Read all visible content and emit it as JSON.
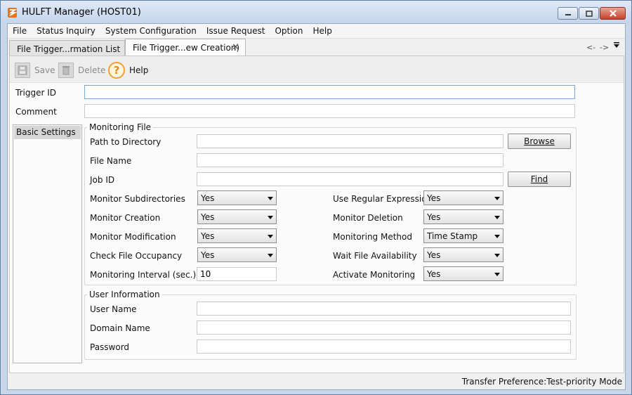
{
  "window": {
    "title": "HULFT Manager (HOST01)",
    "colors": {
      "frame": "#c7d6e9",
      "close": "#c7412b",
      "accent": "#f0a030"
    }
  },
  "menu": [
    {
      "label": "File"
    },
    {
      "label": "Status Inquiry"
    },
    {
      "label": "System Configuration"
    },
    {
      "label": "Issue Request"
    },
    {
      "label": "Option"
    },
    {
      "label": "Help"
    }
  ],
  "tabs": [
    {
      "label": "File Trigger...rmation List"
    },
    {
      "label": "File Trigger...ew Creation)"
    }
  ],
  "tab_nav": {
    "back": "<-",
    "forward": "->"
  },
  "toolbar": {
    "save": {
      "label": "Save",
      "icon": "save-icon"
    },
    "delete": {
      "label": "Delete",
      "icon": "trash-icon"
    },
    "help": {
      "label": "Help",
      "icon": "help-icon"
    }
  },
  "form": {
    "trigger_id": {
      "label": "Trigger ID",
      "value": ""
    },
    "comment": {
      "label": "Comment",
      "value": ""
    }
  },
  "sidebar": {
    "items": [
      {
        "label": "Basic Settings"
      }
    ]
  },
  "monitoring": {
    "legend": "Monitoring File",
    "path_label": "Path to Directory",
    "path_value": "",
    "browse_label": "Browse",
    "file_name_label": "File Name",
    "file_name_value": "",
    "job_id_label": "Job ID",
    "job_id_value": "",
    "find_label": "Find",
    "subdirs_label": "Monitor Subdirectories",
    "subdirs_value": "Yes",
    "regex_label": "Use Regular Expression",
    "regex_value": "Yes",
    "creation_label": "Monitor Creation",
    "creation_value": "Yes",
    "deletion_label": "Monitor Deletion",
    "deletion_value": "Yes",
    "modification_label": "Monitor Modification",
    "modification_value": "Yes",
    "method_label": "Monitoring Method",
    "method_value": "Time Stamp",
    "occupancy_label": "Check File Occupancy",
    "occupancy_value": "Yes",
    "wait_label": "Wait File Availability",
    "wait_value": "Yes",
    "interval_label": "Monitoring Interval (sec.)",
    "interval_value": "10",
    "activate_label": "Activate Monitoring",
    "activate_value": "Yes"
  },
  "user_info": {
    "legend": "User Information",
    "user_name_label": "User Name",
    "user_name_value": "",
    "domain_label": "Domain Name",
    "domain_value": "",
    "password_label": "Password",
    "password_value": ""
  },
  "status": {
    "text": "Transfer Preference:Test-priority Mode"
  }
}
